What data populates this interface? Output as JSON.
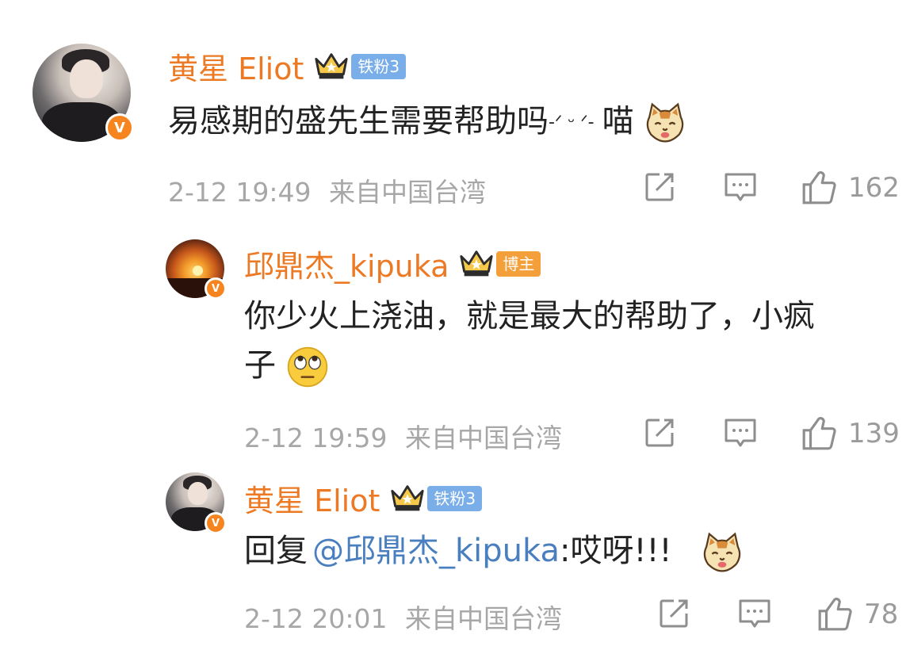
{
  "comments": [
    {
      "username": "黄星 Eliot",
      "fan_badge": "铁粉3",
      "verified_mark": "V",
      "text": "易感期的盛先生需要帮助吗",
      "kaomoji": "-ᐟ ᵕ ᐟ-",
      "text_after": "喵",
      "emoji": "cat-face-emoji",
      "time": "2-12 19:49",
      "location": "来自中国台湾",
      "likes": "162"
    },
    {
      "username": "邱鼎杰_kipuka",
      "fan_badge": "博主",
      "verified_mark": "V",
      "text_line1": "你少火上浇油，就是最大的帮助了，小疯",
      "text_line2": "子",
      "emoji": "eye-roll-emoji",
      "time": "2-12 19:59",
      "location": "来自中国台湾",
      "likes": "139"
    },
    {
      "username": "黄星 Eliot",
      "fan_badge": "铁粉3",
      "verified_mark": "V",
      "reply_prefix": "回复",
      "mention": "@邱鼎杰_kipuka",
      "text": ":哎呀!!!",
      "emoji": "cat-face-emoji",
      "time": "2-12 20:01",
      "location": "来自中国台湾",
      "likes": "78"
    }
  ],
  "icons": {
    "share": "share-icon",
    "comment": "comment-icon",
    "like": "thumbs-up-icon",
    "crown": "crown-icon"
  },
  "colors": {
    "username": "#ec7a25",
    "mention": "#4a7fbf",
    "meta": "#a7a7a7",
    "verified": "#f7851f"
  }
}
